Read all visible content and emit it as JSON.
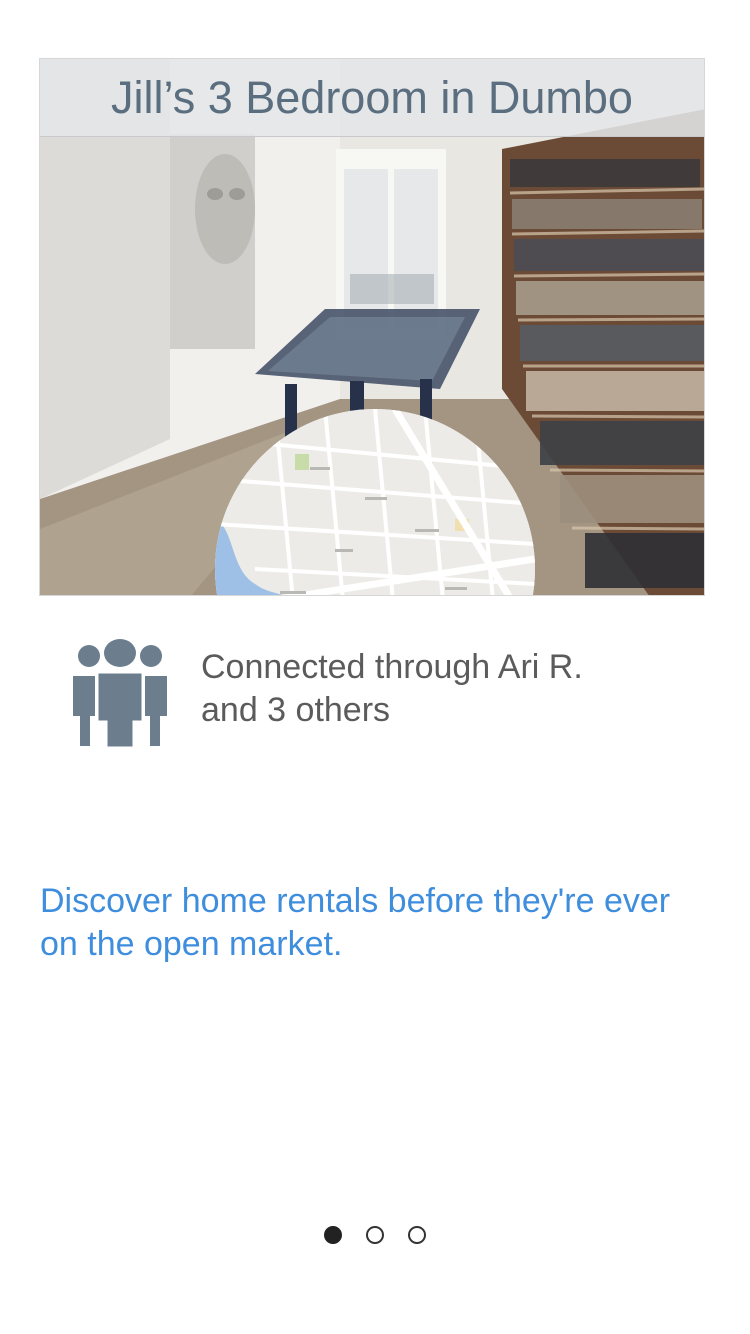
{
  "listing": {
    "title": "Jill’s 3 Bedroom in Dumbo",
    "photo_alt": "hallway-with-bookshelves-photo",
    "map_label": "location-map"
  },
  "connection": {
    "line1": "Connected through Ari R.",
    "line2": "and 3 others",
    "icon": "people-group-icon"
  },
  "tagline": {
    "line1": "Discover home rentals before they're ever",
    "line2": "on the open market."
  },
  "pager": {
    "pages": 3,
    "active_page": 1
  },
  "colors": {
    "title_text": "#5a6e7f",
    "icon": "#6c7e8e",
    "body_text": "#5b5b5b",
    "accent": "#3f8ede"
  }
}
